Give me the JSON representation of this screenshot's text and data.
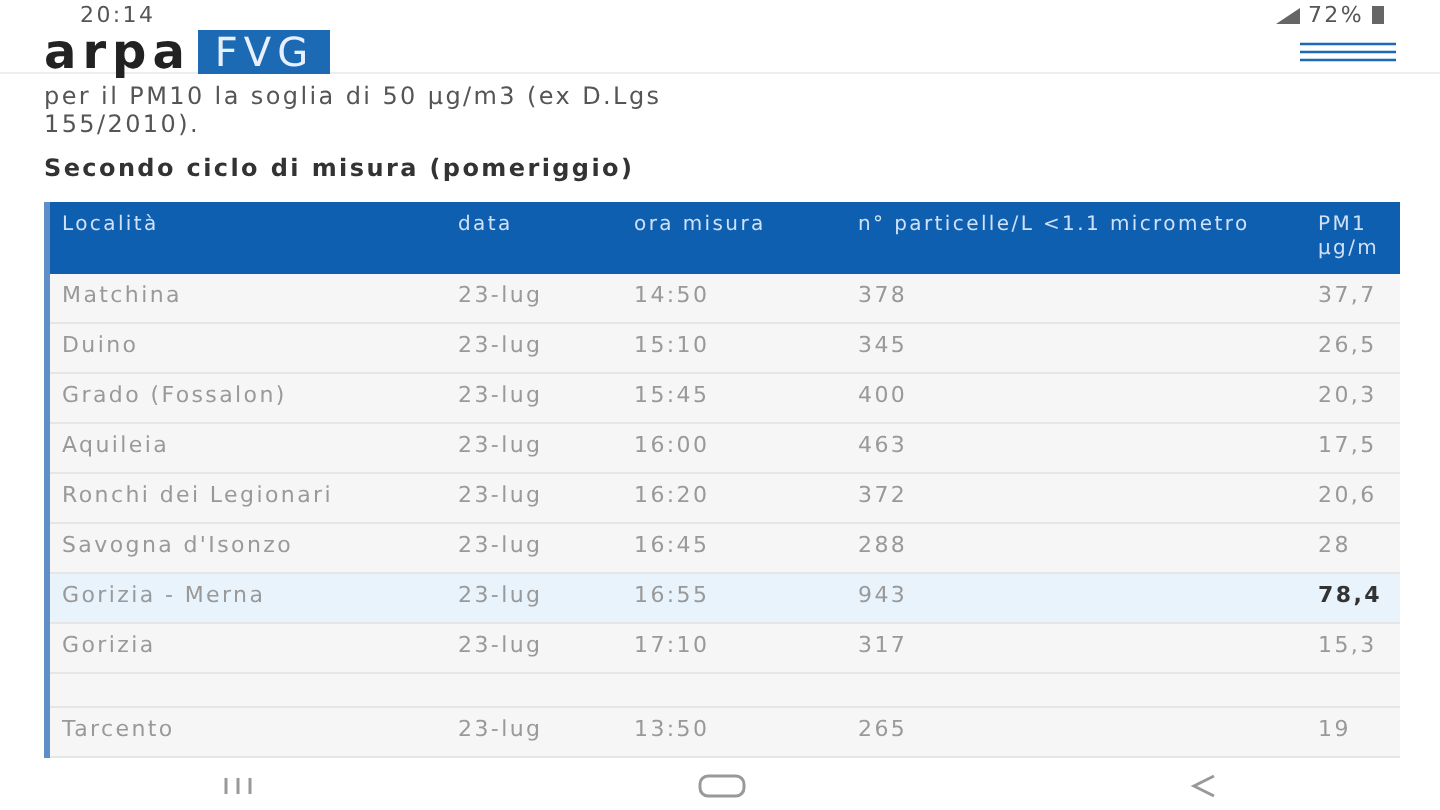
{
  "status_bar": {
    "time": "20:14",
    "battery": "72%"
  },
  "header": {
    "logo_left": "arpa",
    "logo_right": "FVG"
  },
  "intro_lines": [
    "per il PM10 la soglia di 50 µg/m3 (ex D.Lgs",
    "155/2010)."
  ],
  "section_title": "Secondo ciclo di misura (pomeriggio)",
  "table": {
    "columns": [
      "Località",
      "data",
      "ora misura",
      "n° particelle/L <1.1 micrometro",
      "PM1 µg/m"
    ],
    "rows": [
      {
        "kind": "data",
        "cells": [
          "Matchina",
          "23-lug",
          "14:50",
          "378",
          "37,7"
        ],
        "highlighted": false
      },
      {
        "kind": "data",
        "cells": [
          "Duino",
          "23-lug",
          "15:10",
          "345",
          "26,5"
        ],
        "highlighted": false
      },
      {
        "kind": "data",
        "cells": [
          "Grado (Fossalon)",
          "23-lug",
          "15:45",
          "400",
          "20,3"
        ],
        "highlighted": false
      },
      {
        "kind": "data",
        "cells": [
          "Aquileia",
          "23-lug",
          "16:00",
          "463",
          "17,5"
        ],
        "highlighted": false
      },
      {
        "kind": "data",
        "cells": [
          "Ronchi dei Legionari",
          "23-lug",
          "16:20",
          "372",
          "20,6"
        ],
        "highlighted": false
      },
      {
        "kind": "data",
        "cells": [
          "Savogna d'Isonzo",
          "23-lug",
          "16:45",
          "288",
          "28"
        ],
        "highlighted": false
      },
      {
        "kind": "data",
        "cells": [
          "Gorizia - Merna",
          "23-lug",
          "16:55",
          "943",
          "78,4"
        ],
        "highlighted": true
      },
      {
        "kind": "data",
        "cells": [
          "Gorizia",
          "23-lug",
          "17:10",
          "317",
          "15,3"
        ],
        "highlighted": false
      },
      {
        "kind": "spacer"
      },
      {
        "kind": "data",
        "cells": [
          "Tarcento",
          "23-lug",
          "13:50",
          "265",
          "19"
        ],
        "highlighted": false
      }
    ]
  }
}
